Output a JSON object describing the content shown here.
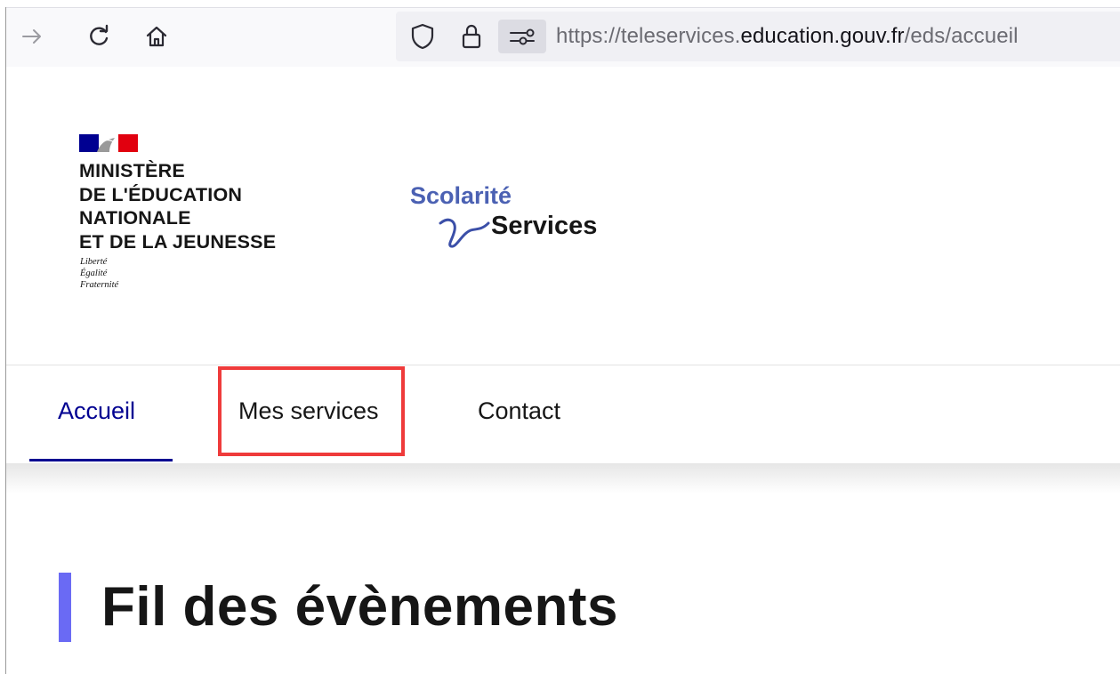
{
  "browser": {
    "url_prefix": "https://teleservices.",
    "url_domain": "education.gouv.fr",
    "url_path": "/eds/accueil",
    "icons": [
      "forward-icon",
      "reload-icon",
      "home-icon",
      "shield-icon",
      "lock-icon",
      "permissions-icon"
    ]
  },
  "header": {
    "ministry_lines": [
      "MINISTÈRE",
      "DE L'ÉDUCATION",
      "NATIONALE",
      "ET DE LA JEUNESSE"
    ],
    "devise_lines": [
      "Liberté",
      "Égalité",
      "Fraternité"
    ],
    "service_brand_top": "Scolarité",
    "service_brand_bottom": "Services"
  },
  "nav": {
    "items": [
      {
        "label": "Accueil",
        "active": true
      },
      {
        "label": "Mes services",
        "active": false,
        "highlighted": true
      },
      {
        "label": "Contact",
        "active": false
      }
    ]
  },
  "main": {
    "title": "Fil des évènements"
  },
  "colors": {
    "nav_active": "#000091",
    "highlight": "#ef3b3b",
    "title_bar": "#6a6af4",
    "brand_blue": "#4b61b3"
  }
}
